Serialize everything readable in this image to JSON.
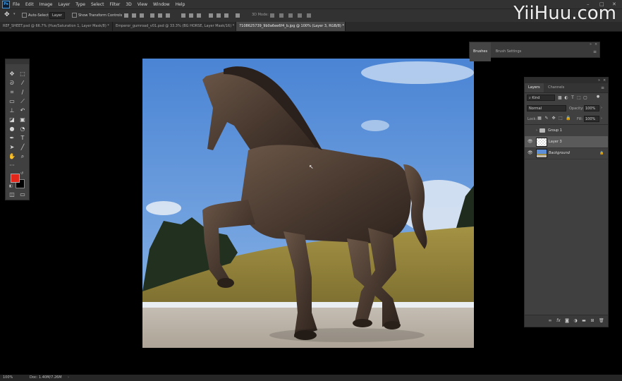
{
  "menubar": {
    "app_icon": "Ps",
    "items": [
      "File",
      "Edit",
      "Image",
      "Layer",
      "Type",
      "Select",
      "Filter",
      "3D",
      "View",
      "Window",
      "Help"
    ],
    "window_controls": [
      "–",
      "□",
      "✕"
    ]
  },
  "optionsbar": {
    "auto_select_label": "Auto-Select",
    "auto_select_target": "Layer",
    "transform_controls_label": "Show Transform Controls",
    "mode_3d_label": "3D Mode:"
  },
  "tabs": [
    {
      "label": "REF_SHEET.psd @ 66.7% (Hue/Saturation 1, Layer Mask/8) *",
      "close": "×",
      "active": false
    },
    {
      "label": "Emperor_gumroad_v01.psd @ 33.3% (BG HORSE, Layer Mask/16) *",
      "close": "×",
      "active": false
    },
    {
      "label": "7108625739_9b0a6ee6f4_b.jpg @ 100% (Layer 3, RGB/8) *",
      "close": "×",
      "active": true
    }
  ],
  "tools": [
    "move-tool",
    "marquee-tool",
    "lasso-tool",
    "quick-select-tool",
    "crop-tool",
    "eyedropper-tool",
    "healing-brush-tool",
    "brush-tool",
    "clone-stamp-tool",
    "history-brush-tool",
    "eraser-tool",
    "gradient-tool",
    "blur-tool",
    "dodge-tool",
    "pen-tool",
    "type-tool",
    "path-select-tool",
    "shape-tool",
    "hand-tool",
    "zoom-tool"
  ],
  "colors": {
    "foreground": "#e3271a",
    "background": "#000000",
    "sky": "#5c8fd8",
    "hill": "#9a8a43",
    "horse": "#4b3a30"
  },
  "brushes_panel": {
    "tabs": [
      "Brushes",
      "Brush Settings"
    ],
    "active_tab": "Brushes"
  },
  "layers_panel": {
    "tabs": [
      "Layers",
      "Channels"
    ],
    "active_tab": "Layers",
    "filter_kind": "Kind",
    "blend_mode": "Normal",
    "opacity_label": "Opacity:",
    "opacity": "100%",
    "lock_label": "Lock:",
    "fill_label": "Fill:",
    "fill": "100%",
    "layers": [
      {
        "name": "Group 1",
        "type": "group",
        "visible": false,
        "selected": false,
        "locked": false
      },
      {
        "name": "Layer 3",
        "type": "pixel",
        "visible": true,
        "selected": true,
        "locked": false
      },
      {
        "name": "Background",
        "type": "pixel",
        "visible": true,
        "selected": false,
        "locked": true
      }
    ]
  },
  "status": {
    "zoom": "100%",
    "doc_info": "Doc: 1.40M/7.26M"
  },
  "watermark": "YiiHuu.com"
}
